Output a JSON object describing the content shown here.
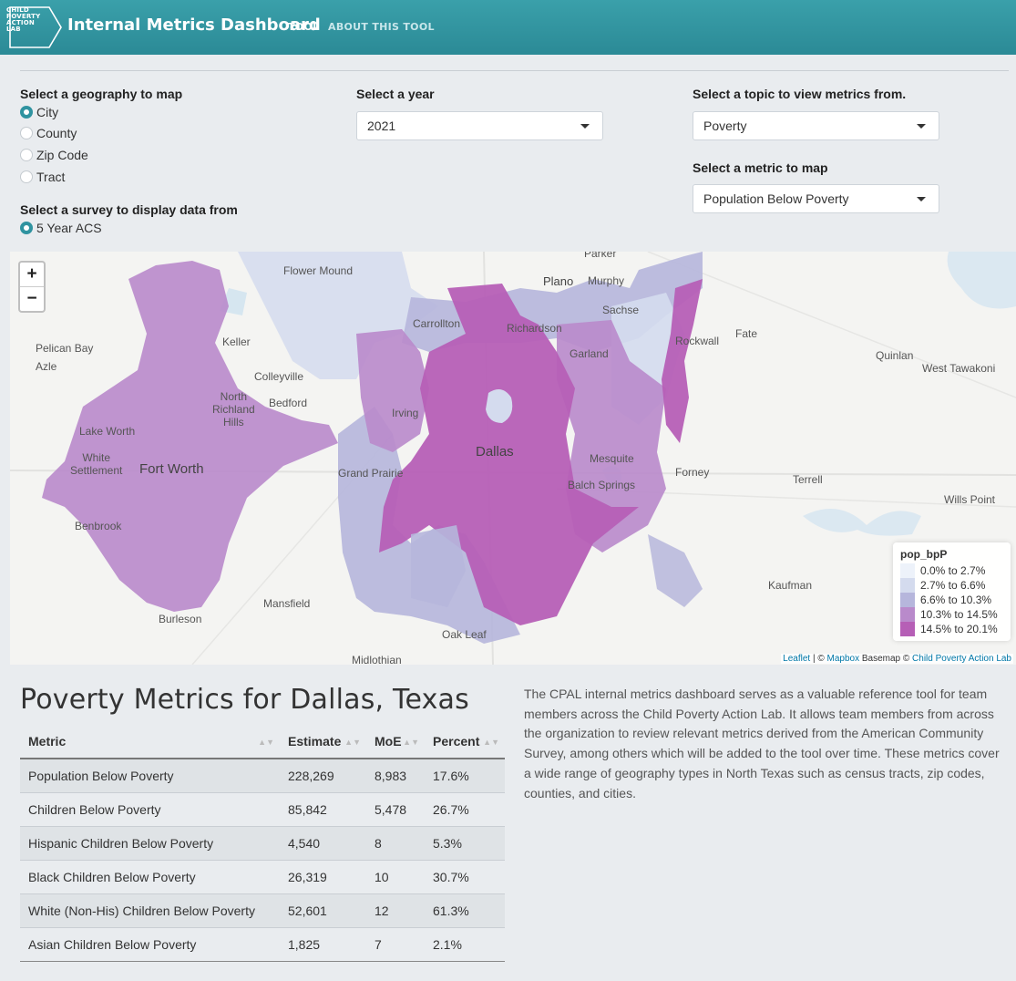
{
  "header": {
    "logo_lines": [
      "CHILD",
      "POVERTY",
      "ACTION",
      "LAB"
    ],
    "title": "Internal Metrics Dashboard",
    "nav": [
      "TOOL",
      "ABOUT THIS TOOL"
    ]
  },
  "controls": {
    "geography_label": "Select a geography to map",
    "geographies": [
      "City",
      "County",
      "Zip Code",
      "Tract"
    ],
    "geography_selected": "City",
    "survey_label": "Select a survey to display data from",
    "survey_option": "5 Year ACS",
    "year_label": "Select a year",
    "year_value": "2021",
    "topic_label": "Select a topic to view metrics from.",
    "topic_value": "Poverty",
    "metric_label": "Select a metric to map",
    "metric_value": "Population Below Poverty"
  },
  "map": {
    "zoom_in": "+",
    "zoom_out": "−",
    "places": {
      "parker": "Parker",
      "flower_mound": "Flower Mound",
      "plano": "Plano",
      "murphy": "Murphy",
      "sachse": "Sachse",
      "carrollton": "Carrollton",
      "richardson": "Richardson",
      "rockwall": "Rockwall",
      "fate": "Fate",
      "pelican_bay": "Pelican Bay",
      "azle": "Azle",
      "keller": "Keller",
      "garland": "Garland",
      "quinlan": "Quinlan",
      "west_tawakoni": "West Tawakoni",
      "colleyville": "Colleyville",
      "north_richland_hills": "North\nRichland\nHills",
      "bedford": "Bedford",
      "irving": "Irving",
      "lake_worth": "Lake Worth",
      "dallas": "Dallas",
      "mesquite": "Mesquite",
      "white_settlement": "White\nSettlement",
      "fort_worth": "Fort Worth",
      "grand_prairie": "Grand Prairie",
      "forney": "Forney",
      "terrell": "Terrell",
      "balch_springs": "Balch Springs",
      "wills_point": "Wills Point",
      "benbrook": "Benbrook",
      "kaufman": "Kaufman",
      "mansfield": "Mansfield",
      "burleson": "Burleson",
      "oak_leaf": "Oak Leaf",
      "midlothian": "Midlothian"
    },
    "legend": {
      "title": "pop_bpP",
      "items": [
        {
          "label": "0.0% to 2.7%",
          "color": "#edf2fa"
        },
        {
          "label": "2.7% to 6.6%",
          "color": "#d4dbee"
        },
        {
          "label": "6.6% to 10.3%",
          "color": "#b6b6dc"
        },
        {
          "label": "10.3% to 14.5%",
          "color": "#b98acb"
        },
        {
          "label": "14.5% to 20.1%",
          "color": "#b65fb6"
        }
      ]
    },
    "attribution": {
      "leaflet": "Leaflet",
      "sep1": " | © ",
      "mapbox": "Mapbox",
      "basemap": " Basemap © ",
      "cpal": "Child Poverty Action Lab"
    }
  },
  "metrics": {
    "title": "Poverty Metrics for Dallas, Texas",
    "columns": [
      "Metric",
      "Estimate",
      "MoE",
      "Percent"
    ],
    "rows": [
      [
        "Population Below Poverty",
        "228,269",
        "8,983",
        "17.6%"
      ],
      [
        "Children Below Poverty",
        "85,842",
        "5,478",
        "26.7%"
      ],
      [
        "Hispanic Children Below Poverty",
        "4,540",
        "8",
        "5.3%"
      ],
      [
        "Black Children Below Poverty",
        "26,319",
        "10",
        "30.7%"
      ],
      [
        "White (Non-His) Children Below Poverty",
        "52,601",
        "12",
        "61.3%"
      ],
      [
        "Asian Children Below Poverty",
        "1,825",
        "7",
        "2.1%"
      ]
    ]
  },
  "description": "The CPAL internal metrics dashboard serves as a valuable reference tool for team members across the Child Poverty Action Lab. It allows team members from across the organization to review relevant metrics derived from the American Community Survey, among others which will be added to the tool over time. These metrics cover a wide range of geography types in North Texas such as census tracts, zip codes, counties, and cities."
}
